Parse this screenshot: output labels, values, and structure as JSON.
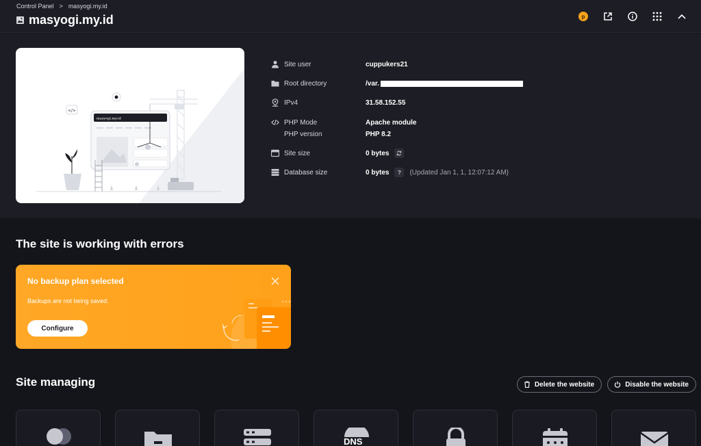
{
  "header": {
    "breadcrumb": [
      "Control Panel",
      "masyogi.my.id"
    ],
    "breadcrumb_sep": ">",
    "title": "masyogi.my.id",
    "icons": [
      "coin-icon",
      "external-link-icon",
      "info-icon",
      "apps-grid-icon",
      "chevron-up-icon"
    ],
    "coin_glyph": "p"
  },
  "preview": {
    "site_label": "masyogi.my.id"
  },
  "site_info": {
    "rows": [
      {
        "icon": "user-icon",
        "label": "Site user",
        "value": "cuppukers21"
      },
      {
        "icon": "folder-icon",
        "label": "Root directory",
        "value": "/var."
      },
      {
        "icon": "location-pin-icon",
        "label": "IPv4",
        "value": "31.58.152.55"
      },
      {
        "icon": "code-icon",
        "label": "PHP Mode",
        "value": "Apache module"
      },
      {
        "label": "PHP version",
        "value": "PHP 8.2"
      },
      {
        "icon": "storage-icon",
        "label": "Site size",
        "value": "0 bytes",
        "action_icon": "refresh-icon"
      },
      {
        "icon": "database-icon",
        "label": "Database size",
        "value": "0 bytes",
        "action_glyph": "?",
        "note": "(Updated Jan 1, 1, 12:07:12 AM)"
      }
    ]
  },
  "errors_section": {
    "title": "The site is working with errors"
  },
  "backup_alert": {
    "title": "No backup plan selected",
    "text": "Backups are not being saved.",
    "button_label": "Configure",
    "colors": {
      "background": "#ffa726",
      "art": "#ff9d14"
    }
  },
  "managing": {
    "title": "Site managing",
    "delete_label": "Delete the website",
    "disable_label": "Disable the website",
    "tiles": [
      "theme-icon",
      "file-manager-icon",
      "server-icon",
      "dns-icon",
      "ssl-lock-icon",
      "cron-calendar-icon",
      "mail-icon"
    ],
    "dns_glyph": "DNS"
  },
  "colors": {
    "page_bg": "#14151b",
    "panel_bg": "#1d1e25",
    "accent_orange": "#f7a21b"
  }
}
